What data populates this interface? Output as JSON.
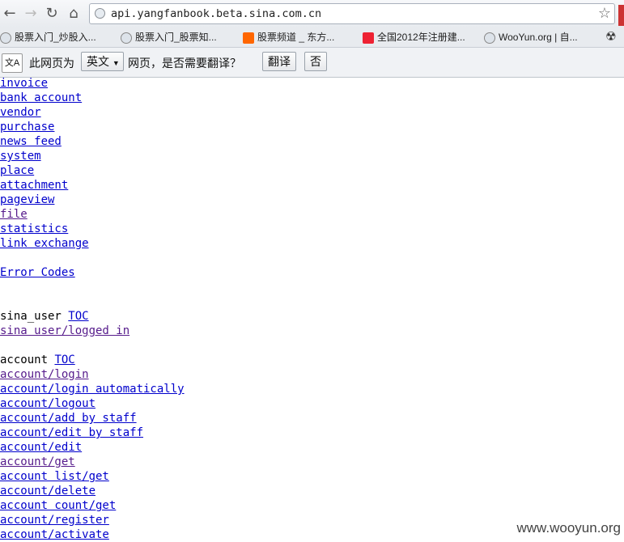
{
  "browser": {
    "url": "api.yangfanbook.beta.sina.com.cn",
    "bookmarks": [
      "股票入门_炒股入...",
      "股票入门_股票知...",
      "股票频道 _ 东方...",
      "全国2012年注册建...",
      "WooYun.org | 自..."
    ]
  },
  "translate_bar": {
    "icon_text": "文A",
    "prefix": "此网页为",
    "language": "英文",
    "suffix": "网页，是否需要翻译？",
    "translate_button": "翻译",
    "no_button": "否"
  },
  "content": {
    "links_top": [
      "invoice",
      "bank account",
      "vendor",
      "purchase",
      "news feed",
      "system",
      "place",
      "attachment",
      "pageview",
      "file",
      "statistics",
      "link exchange"
    ],
    "error_codes": "Error Codes",
    "sina_user_heading": "sina_user",
    "toc": "TOC",
    "sina_user_links": [
      "sina user/logged in"
    ],
    "account_heading": "account",
    "account_links": [
      "account/login",
      "account/login automatically",
      "account/logout",
      "account/add by staff",
      "account/edit by staff",
      "account/edit",
      "account/get",
      "account list/get",
      "account/delete",
      "account count/get",
      "account/register",
      "account/activate"
    ]
  },
  "watermark": "www.wooyun.org",
  "colors": {
    "link": "#0000cc",
    "visited": "#551a8b"
  }
}
